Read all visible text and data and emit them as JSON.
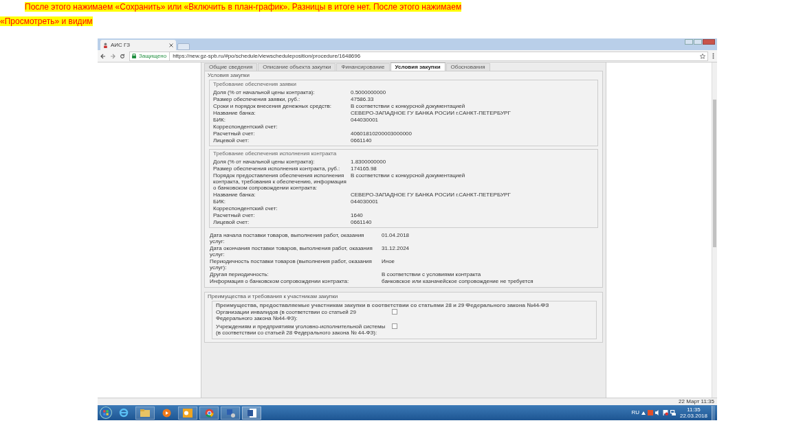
{
  "instruction": "После этого нажимаем «Сохранить» или «Включить в план-график».  Разницы в итоге нет. После этого нажимаем\n«Просмотреть» и видим",
  "browser": {
    "tab_title": "АИС ГЗ",
    "secure_label": "Защищено",
    "url": "https://new.gz-spb.ru/#po/schedule/viewscheduleposition/procedure/1648696"
  },
  "page_tabs": [
    {
      "label": "Общие сведения",
      "selected": false
    },
    {
      "label": "Описание объекта закупки",
      "selected": false
    },
    {
      "label": "Финансирование",
      "selected": false
    },
    {
      "label": "Условия закупки",
      "selected": true
    },
    {
      "label": "Обоснования",
      "selected": false
    }
  ],
  "conditions": {
    "title": "Условия закупки",
    "groups": [
      {
        "title": "Требование обеспечения заявки",
        "rows": [
          {
            "label": "Доля (% от начальной цены контракта):",
            "value": "0.5000000000"
          },
          {
            "label": "Размер обеспечения заявки, руб.:",
            "value": "47586.33"
          },
          {
            "label": "Сроки и порядок внесения денежных средств:",
            "value": "В соответствии с конкурсной документацией"
          },
          {
            "label": "Название банка:",
            "value": "СЕВЕРО-ЗАПАДНОЕ ГУ БАНКА РОСИИ г.САНКТ-ПЕТЕРБУРГ"
          },
          {
            "label": "БИК:",
            "value": "044030001"
          },
          {
            "label": "Корреспондентский счет:"
          },
          {
            "label": "Расчетный счет:",
            "value": "40601810200003000000"
          },
          {
            "label": "Лицевой счет:",
            "value": "0661140"
          }
        ]
      },
      {
        "title": "Требование обеспечения исполнения контракта",
        "rows": [
          {
            "label": "Доля (% от начальной цены контракта):",
            "value": "1.8300000000"
          },
          {
            "label": "Размер обеспечения исполнения контракта, руб.:",
            "value": "174165.98"
          },
          {
            "label": "Порядок предоставления обеспечения исполнения контракта, требования к обеспечению, информация о банковском сопровождении контракта:",
            "value": "В соответствии с конкурсной документацией"
          },
          {
            "label": "Название банка:",
            "value": "СЕВЕРО-ЗАПАДНОЕ ГУ БАНКА РОСИИ г.САНКТ-ПЕТЕРБУРГ"
          },
          {
            "label": "БИК:",
            "value": "044030001"
          },
          {
            "label": "Корреспондентский счет:"
          },
          {
            "label": "Расчетный счет:",
            "value": "1640"
          },
          {
            "label": "Лицевой счет:",
            "value": "0661140"
          }
        ]
      }
    ],
    "rows": [
      {
        "label": "Дата начала поставки товаров, выполнения работ, оказания услуг:",
        "value": "01.04.2018"
      },
      {
        "label": "Дата окончания поставки товаров, выполнения работ, оказания услуг:",
        "value": "31.12.2024"
      },
      {
        "label": "Периодичность поставки товаров (выполнения работ, оказания услуг):",
        "value": "Иное"
      },
      {
        "label": "Другая периодичность:",
        "value": "В соответствии с условиями контракта"
      },
      {
        "label": "Информация о банковском сопровождении контракта:",
        "value": "банковское или казначейское сопровождение не требуется"
      }
    ]
  },
  "advantages": {
    "title": "Преимущества и требования к участникам закупки",
    "group": {
      "title": "Преимущества, предоставляемые участникам закупки в соответствии со статьями 28 и 29 Федерального закона №44-ФЗ",
      "rows": [
        {
          "label": "Организации инвалидов (в соответствии со статьей 29 Федерального закона №44-ФЗ):",
          "checked": false
        },
        {
          "label": "Учреждениям и предприятиям уголовно-исполнительной системы (в соответствии со статьей 28 Федерального закона № 44-ФЗ):",
          "checked": false
        }
      ]
    }
  },
  "status_date": "22 Март 11:35",
  "taskbar": {
    "language": "RU",
    "time": "11:35",
    "date": "22.03.2018"
  }
}
